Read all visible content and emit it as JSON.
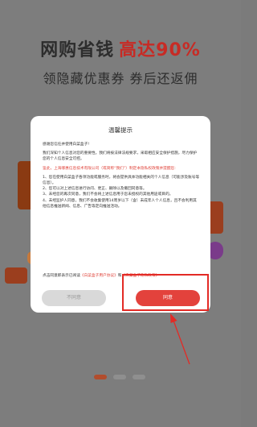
{
  "hero": {
    "line1_part1": "网购省钱",
    "line1_part2": "高达90%",
    "line2": "领隐藏优惠券 券后还返佣"
  },
  "dialog": {
    "title": "温馨提示",
    "intro": "感谢您信任并使用白菜盒子!",
    "para1": "我们深知个人信息对您的重要性。我们将按法律法规要求，采取相应安全保护措施，尽力保护您的个人信息安全可控。",
    "para2_red": "鉴此，上海哪惠信息技术有限公司（或简称“我们”）制定本隐私权政策并提醒您:",
    "items": [
      "1、您在使用白菜盒子各项功能或服务时，将会提供具体功能相关的个人信息（可能涉及账号等信息）。",
      "2、您可以对上述信息进行访问、更正、删除以及撤回同意等。",
      "3、未经您的再次同意，我们不会将上述信息用于您未授权的其他用途或目的。",
      "4、未经监护人同意，我们不会收集使用14周岁以下（含）未成年人个人信息，且不会利用其他信息推送新闻、信息、广告等定向推送活动。"
    ],
    "footer_prefix": "点击同意即表示已阅读",
    "footer_link1": "《白菜盒子用户协议》",
    "footer_and": "和",
    "footer_link2": "《白菜盒子隐私政策》",
    "disagree_label": "不同意",
    "agree_label": "同意"
  },
  "colors": {
    "accent_red": "#e3423c",
    "highlight_border": "#e32a25"
  }
}
